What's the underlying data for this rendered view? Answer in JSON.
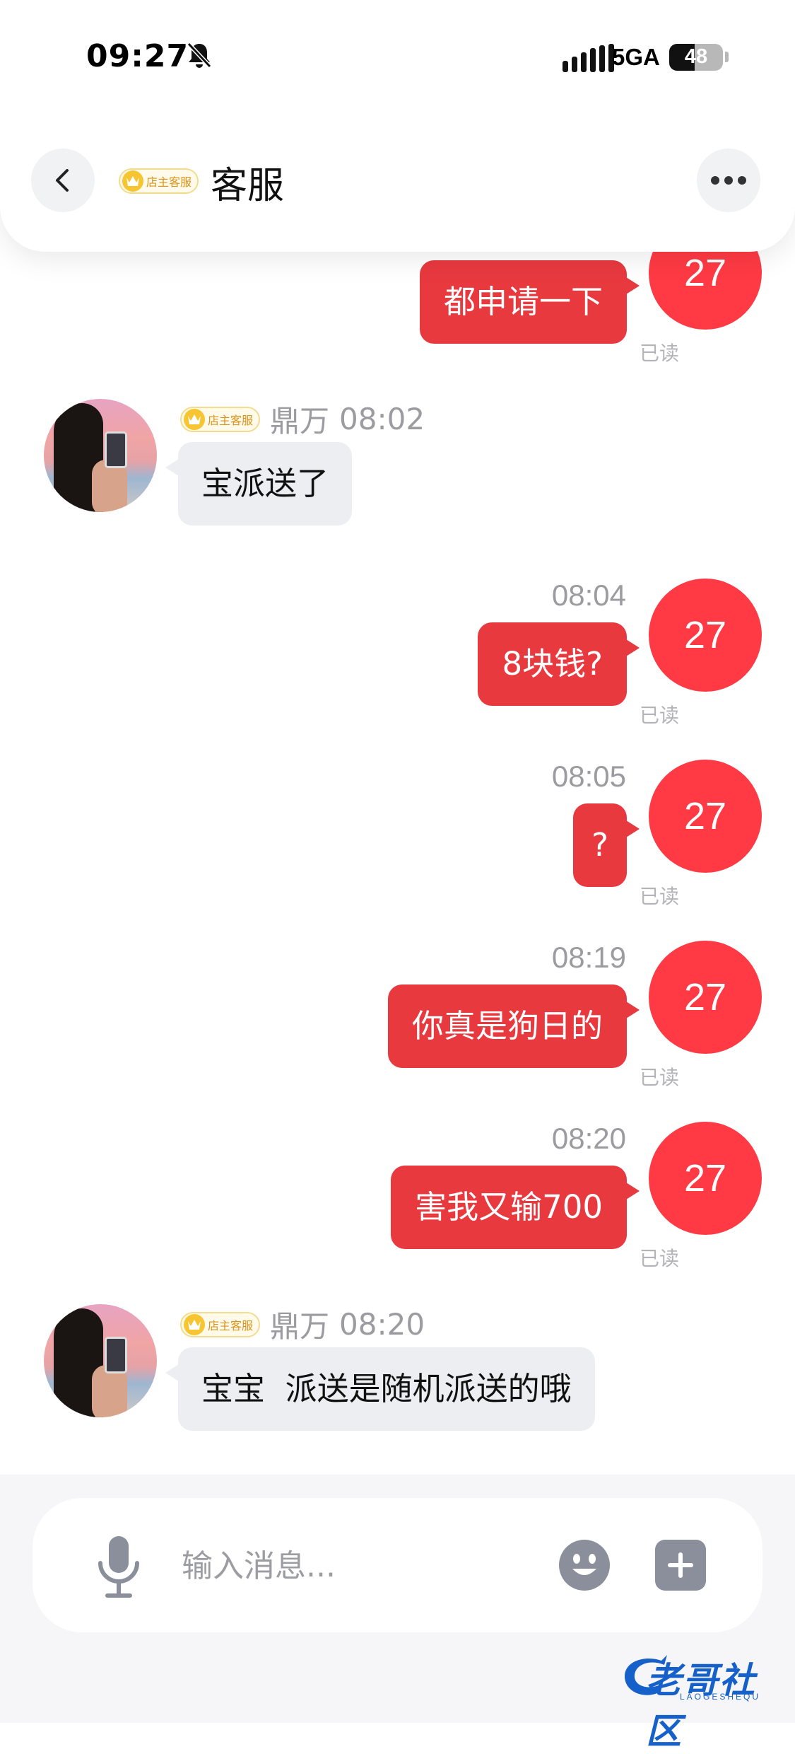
{
  "status_bar": {
    "time": "09:27",
    "network": "5GA",
    "battery": "48",
    "battery_level": 0.48
  },
  "header": {
    "badge": "店主客服",
    "title": "客服"
  },
  "chat": {
    "partial_sent": {
      "text": "都申请一下",
      "avatar": "27",
      "read": "已读"
    },
    "recv1": {
      "badge": "店主客服",
      "name": "鼎万",
      "time": "08:02",
      "text": "宝派送了"
    },
    "sent1": {
      "time": "08:04",
      "text": "8块钱?",
      "avatar": "27",
      "read": "已读"
    },
    "sent2": {
      "time": "08:05",
      "text": "?",
      "avatar": "27",
      "read": "已读"
    },
    "sent3": {
      "time": "08:19",
      "text": "你真是狗日的",
      "avatar": "27",
      "read": "已读"
    },
    "sent4": {
      "time": "08:20",
      "text": "害我又输700",
      "avatar": "27",
      "read": "已读"
    },
    "recv2": {
      "badge": "店主客服",
      "name": "鼎万",
      "time": "08:20",
      "text": "宝宝  派送是随机派送的哦"
    }
  },
  "input": {
    "placeholder": "输入消息..."
  },
  "watermark": {
    "text": "老哥社区",
    "sub": "LAOGESHEQU"
  },
  "colors": {
    "sent_bubble": "#e8393f",
    "self_avatar": "#ff3a44",
    "recv_bubble": "#eceef1",
    "badge_gold": "#f7c532"
  }
}
